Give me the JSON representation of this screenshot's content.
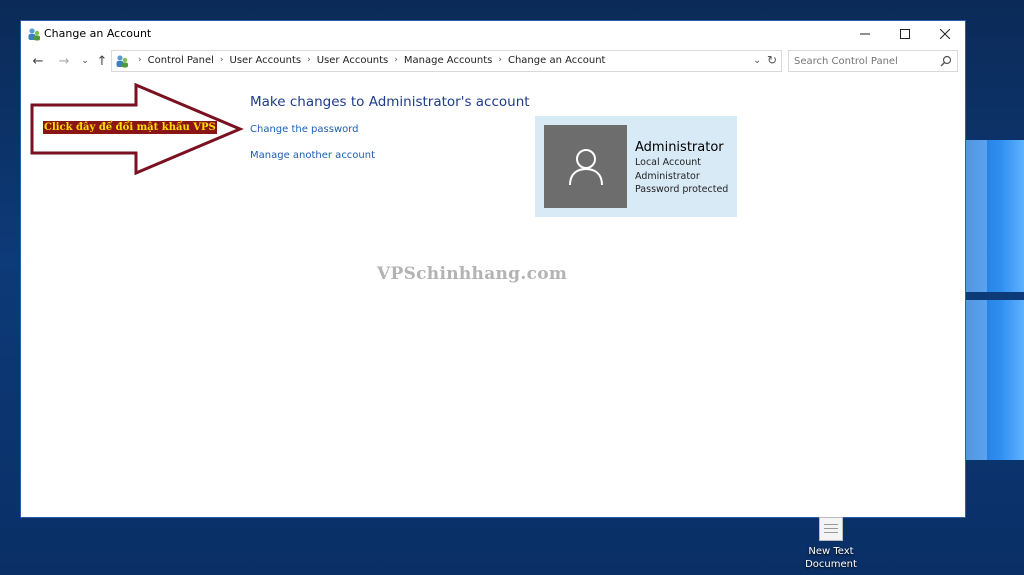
{
  "window": {
    "title": "Change an Account"
  },
  "addressbar": {
    "crumbs": [
      "Control Panel",
      "User Accounts",
      "User Accounts",
      "Manage Accounts",
      "Change an Account"
    ]
  },
  "search": {
    "placeholder": "Search Control Panel"
  },
  "main": {
    "heading": "Make changes to Administrator's account",
    "links": [
      "Change the password",
      "Manage another account"
    ]
  },
  "account": {
    "name": "Administrator",
    "type": "Local Account",
    "group": "Administrator",
    "status": "Password protected"
  },
  "annotation": {
    "callout": "Click đây để đổi mật khẩu VPS",
    "watermark": "VPSchinhhang.com",
    "colors": {
      "arrow": "#7a1020",
      "callout_bg": "#8b1414",
      "callout_text": "#ffe000"
    }
  },
  "desktop": {
    "icon_label_1": "New Text",
    "icon_label_2": "Document"
  }
}
